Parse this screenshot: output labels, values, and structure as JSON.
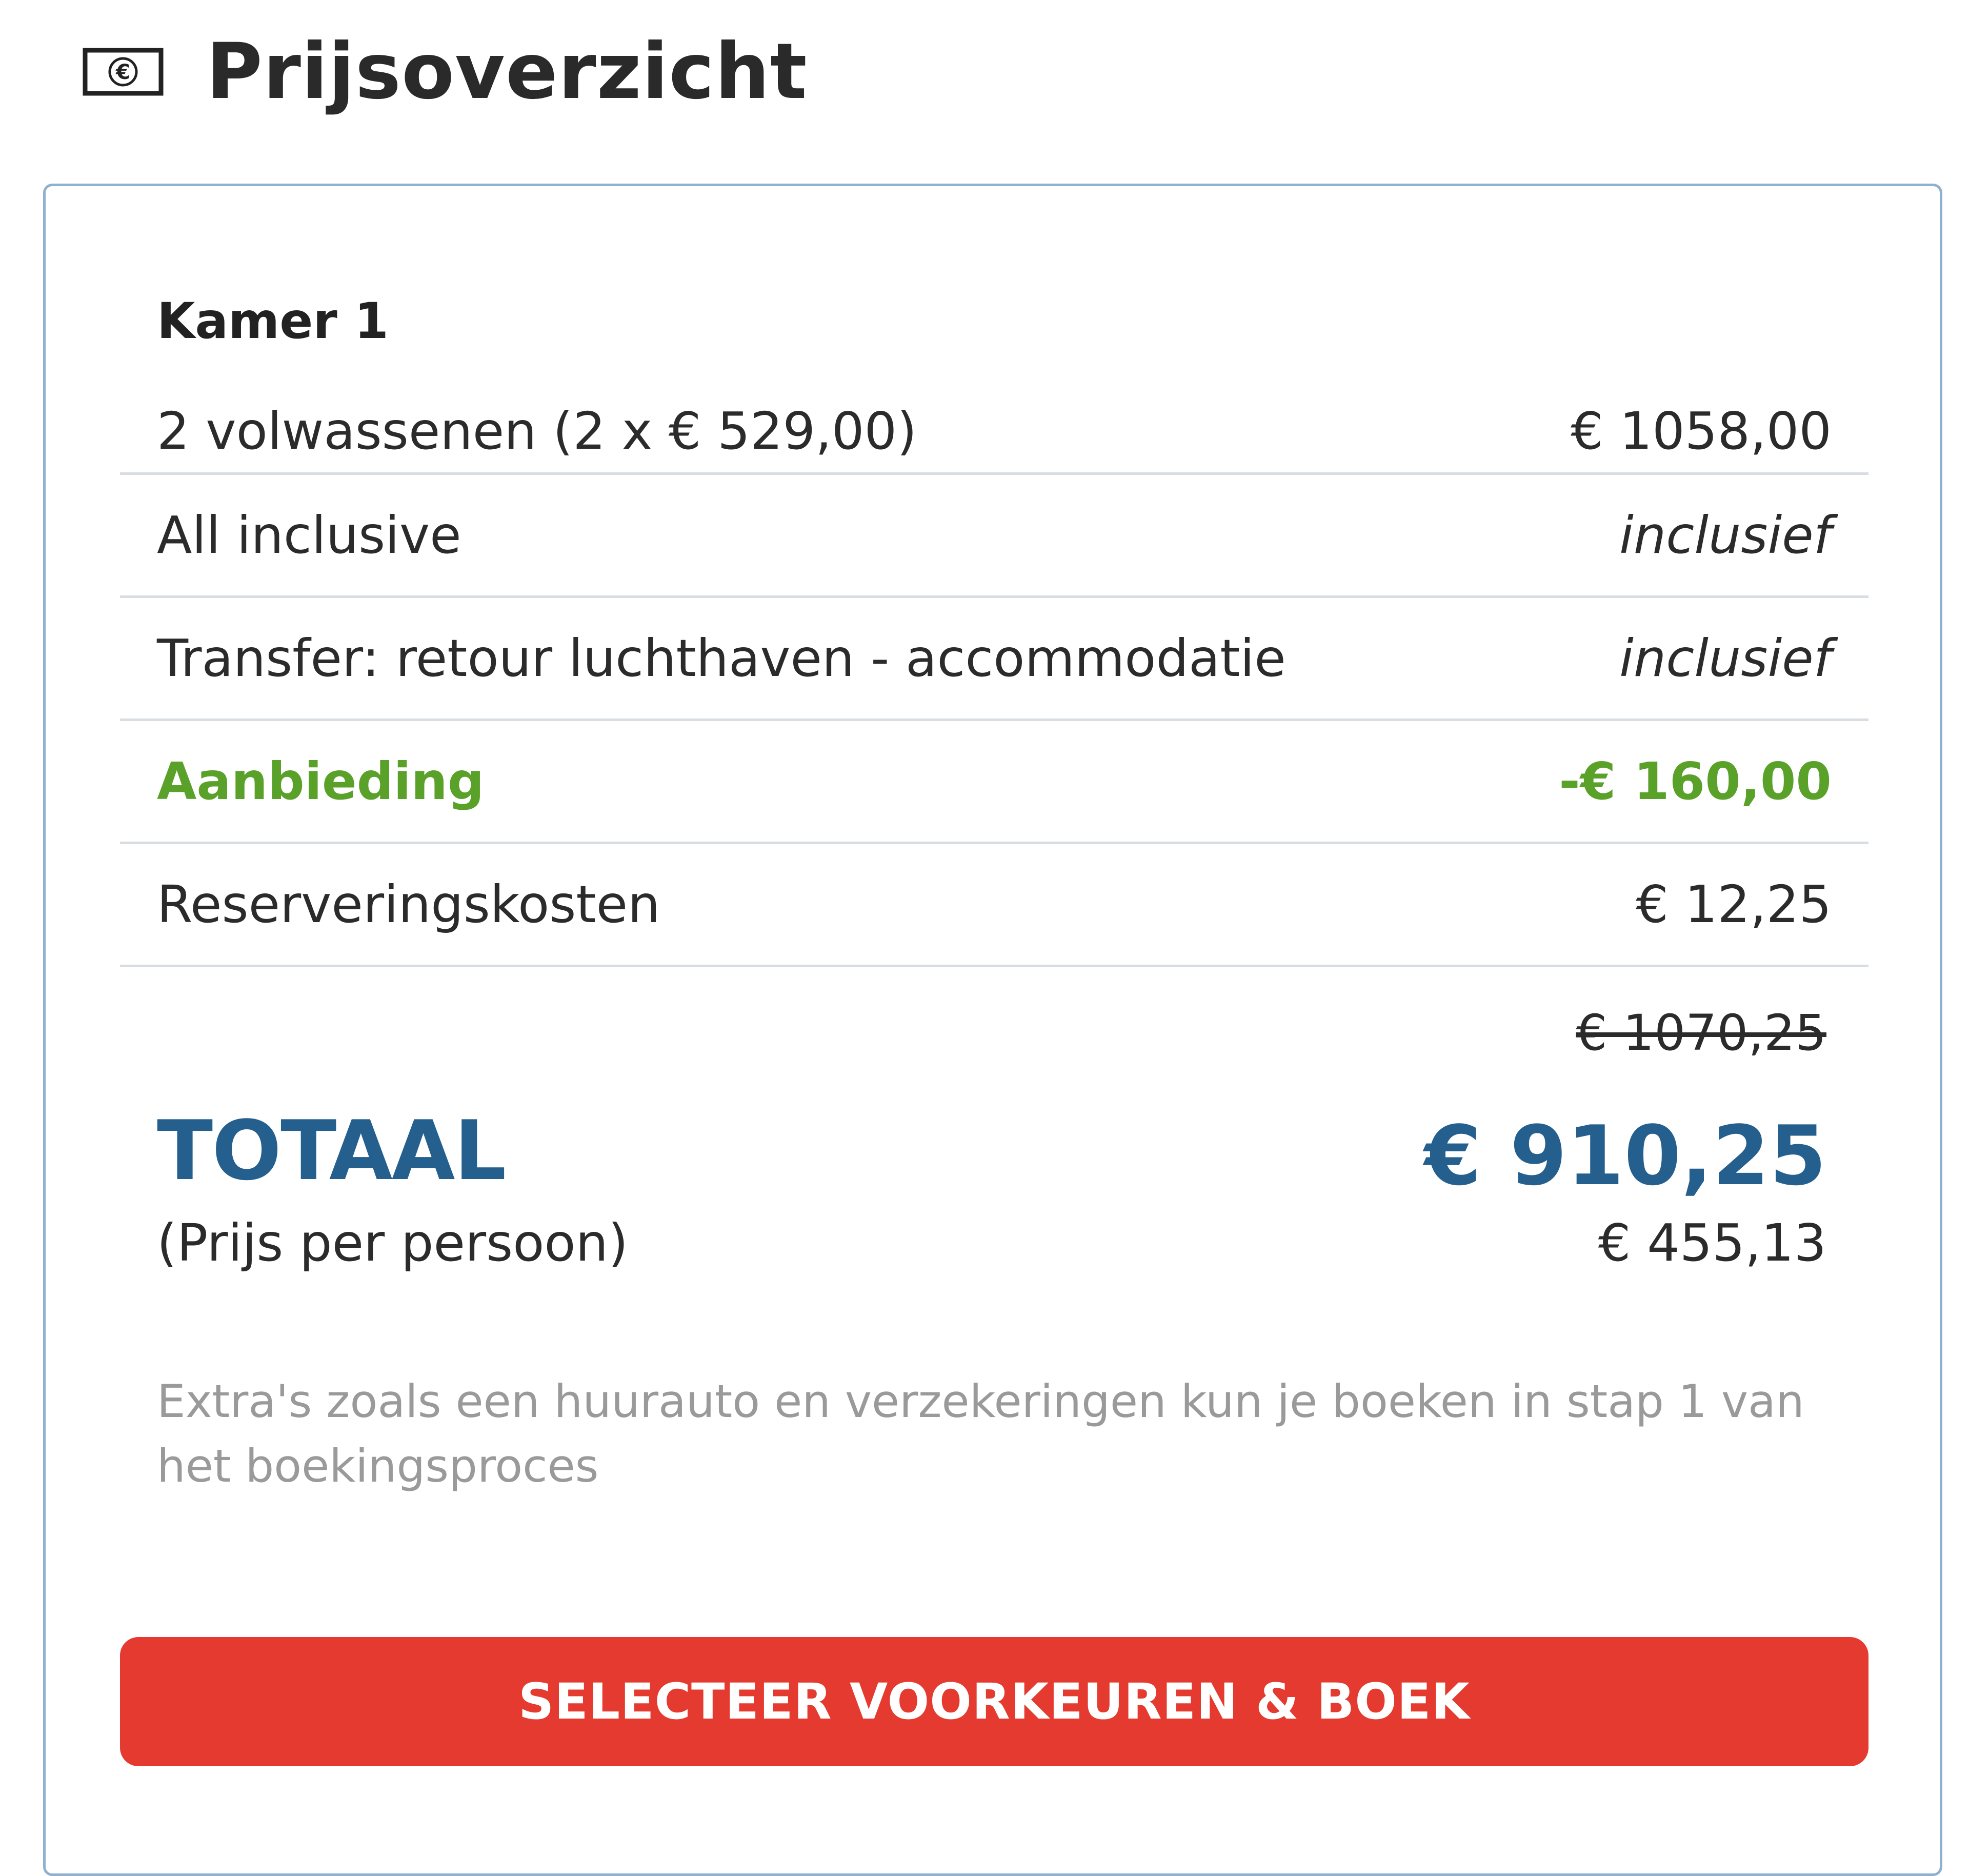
{
  "header": {
    "icon": "euro-banknote-icon",
    "title": "Prijsoverzicht"
  },
  "room": {
    "title": "Kamer 1"
  },
  "lines": [
    {
      "label": "2 volwassenen (2 x € 529,00)",
      "value": "€ 1058,00"
    },
    {
      "label": "All inclusive",
      "value": "inclusief"
    },
    {
      "label": "Transfer: retour luchthaven - accommodatie",
      "value": "inclusief"
    },
    {
      "label": "Aanbieding",
      "value": "-€ 160,00"
    },
    {
      "label": "Reserveringskosten",
      "value": "€ 12,25"
    }
  ],
  "totals": {
    "original_price": "€ 1070,25",
    "label": "TOTAAL",
    "value": "€ 910,25",
    "per_person_label": "(Prijs per persoon)",
    "per_person_value": "€ 455,13"
  },
  "note": "Extra's zoals een huurauto en verzekeringen kun je boeken in stap 1 van het boekingsproces",
  "cta": {
    "label": "SELECTEER VOORKEUREN & BOEK"
  },
  "colors": {
    "accent_blue": "#245f8e",
    "offer_green": "#5aa12a",
    "cta_red": "#e53a2f",
    "panel_border": "#8fb1cf"
  }
}
